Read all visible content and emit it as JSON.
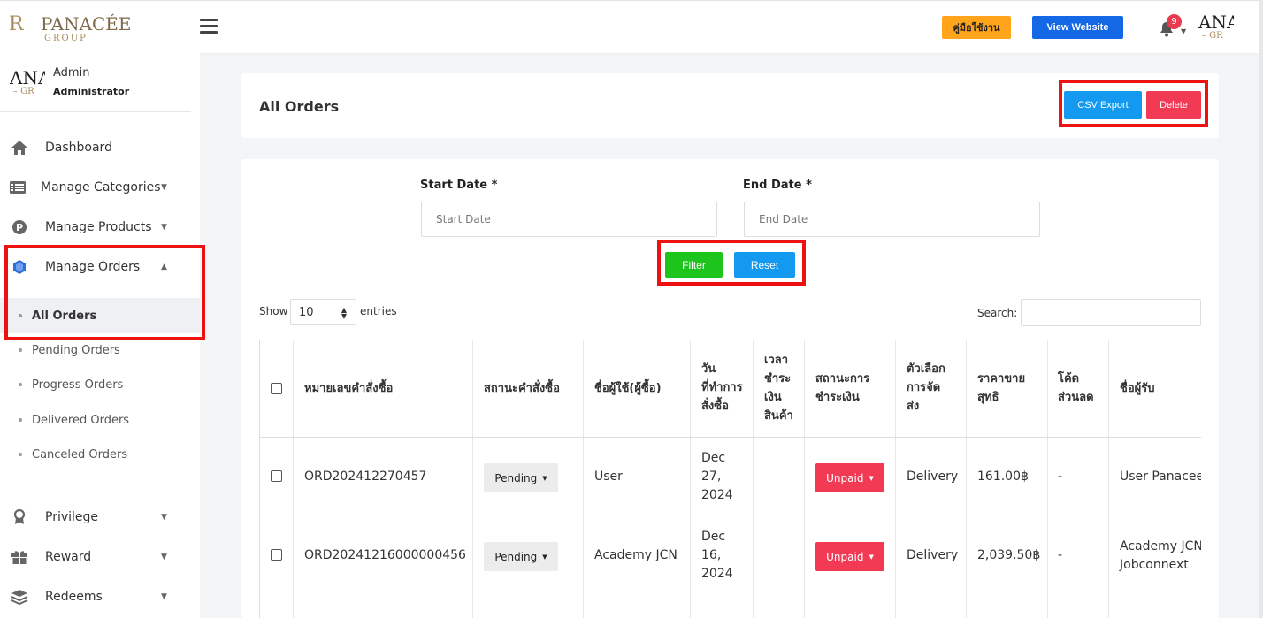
{
  "header": {
    "logo_mark": "R",
    "logo_text": "PANACÉE",
    "logo_sub": "GROUP",
    "guide_label": "คู่มือใช้งาน",
    "website_label": "View Website",
    "notification_count": "9",
    "avatar_line1": "ANA",
    "avatar_line2": "– GR"
  },
  "sidebar": {
    "user_name": "Admin",
    "user_role": "Administrator",
    "avatar_line1": "ANA",
    "avatar_line2": "– GR",
    "nav": [
      {
        "label": "Dashboard",
        "icon": "home-icon"
      },
      {
        "label": "Manage Categories",
        "icon": "list-icon"
      },
      {
        "label": "Manage Products",
        "icon": "product-p-icon"
      },
      {
        "label": "Manage Orders",
        "icon": "orders-icon"
      },
      {
        "label": "Privilege",
        "icon": "award-icon"
      },
      {
        "label": "Reward",
        "icon": "gift-icon"
      },
      {
        "label": "Redeems",
        "icon": "layers-icon"
      }
    ],
    "orders_sub": [
      {
        "label": "All Orders"
      },
      {
        "label": "Pending Orders"
      },
      {
        "label": "Progress Orders"
      },
      {
        "label": "Delivered Orders"
      },
      {
        "label": "Canceled Orders"
      }
    ]
  },
  "main": {
    "title": "All Orders",
    "csv_label": "CSV Export",
    "delete_label": "Delete",
    "start_date_label": "Start Date *",
    "end_date_label": "End Date *",
    "start_date_placeholder": "Start Date",
    "end_date_placeholder": "End Date",
    "filter_label": "Filter",
    "reset_label": "Reset",
    "show_label": "Show",
    "entries_value": "10",
    "entries_label": "entries",
    "search_label": "Search:"
  },
  "table": {
    "columns": [
      [
        "หมายเลขคำสั่งซื้อ"
      ],
      [
        "สถานะคำสั่งซื้อ"
      ],
      [
        "ชื่อผู้ใช้(ผู้ซื้อ)"
      ],
      [
        "วัน",
        "ที่ทำการ",
        "สั่งซื้อ"
      ],
      [
        "เวลา",
        "ชำระ",
        "เงิน",
        "สินค้า"
      ],
      [
        "สถานะการ",
        "ชำระเงิน"
      ],
      [
        "ตัวเลือก",
        "การจัด",
        "ส่ง"
      ],
      [
        "ราคาขาย",
        "สุทธิ"
      ],
      [
        "โค้ด",
        "ส่วนลด"
      ],
      [
        "ชื่อผู้รับ"
      ]
    ],
    "rows": [
      {
        "order_no": "ORD202412270457",
        "status": "Pending",
        "buyer": "User",
        "date": [
          "Dec",
          "27,",
          "2024"
        ],
        "pay_time": "",
        "payment": "Unpaid",
        "shipping": "Delivery",
        "net_price": "161.00฿",
        "discount": "-",
        "receiver": [
          "User Panacee"
        ]
      },
      {
        "order_no": "ORD20241216000000456",
        "status": "Pending",
        "buyer": "Academy JCN",
        "date": [
          "Dec",
          "16,",
          "2024"
        ],
        "pay_time": "",
        "payment": "Unpaid",
        "shipping": "Delivery",
        "net_price": "2,039.50฿",
        "discount": "-",
        "receiver": [
          "Academy JCN",
          "Jobconnext"
        ]
      }
    ]
  },
  "colors": {
    "accent_red": "#ee1111",
    "btn_blue": "#139af0",
    "btn_green": "#1cc41c",
    "btn_pink": "#f23a55",
    "btn_orange": "#ffa41b",
    "logo_gold": "#a98c5c"
  }
}
